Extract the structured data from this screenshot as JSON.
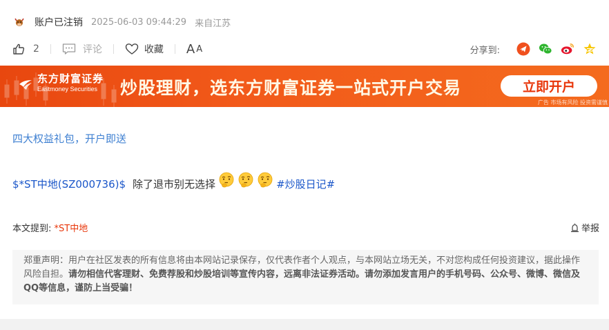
{
  "author": {
    "name": "账户已注销",
    "datetime": "2025-06-03 09:44:29",
    "location": "来自江苏"
  },
  "actions": {
    "like_count": "2",
    "comment_label": "评论",
    "favorite_label": "收藏",
    "font_big": "A",
    "font_small": "A"
  },
  "share": {
    "label": "分享到:",
    "icons": [
      "telegram-like-icon",
      "wechat-icon",
      "weibo-icon",
      "qzone-star-icon"
    ]
  },
  "banner": {
    "brand_cn": "东方财富证券",
    "brand_en": "Eastmoney Securities",
    "slogan": "炒股理财，选东方财富证券一站式开户交易",
    "button": "立即开户",
    "ad_note": "广告 市场有风险 投资需谨慎"
  },
  "post": {
    "gift_link": "四大权益礼包，开户即送",
    "stock_tag": "$*ST中地(SZ000736)$",
    "body": "除了退市别无选择",
    "emoji_count": 3,
    "topic": "#炒股日记#"
  },
  "mention": {
    "label": "本文提到:",
    "stock": "*ST中地"
  },
  "report_label": "举报",
  "disclaimer": {
    "plain": "郑重声明：用户在社区发表的所有信息将由本网站记录保存，仅代表作者个人观点，与本网站立场无关，不对您构成任何投资建议，据此操作风险自担。",
    "bold": "请勿相信代客理财、免费荐股和炒股培训等宣传内容，远离非法证券活动。请勿添加发言用户的手机号码、公众号、微博、微信及QQ等信息，谨防上当受骗！"
  },
  "colors": {
    "link_blue": "#1a56c9",
    "banner_orange": "#f25a1a",
    "stock_red": "#e8360a"
  }
}
